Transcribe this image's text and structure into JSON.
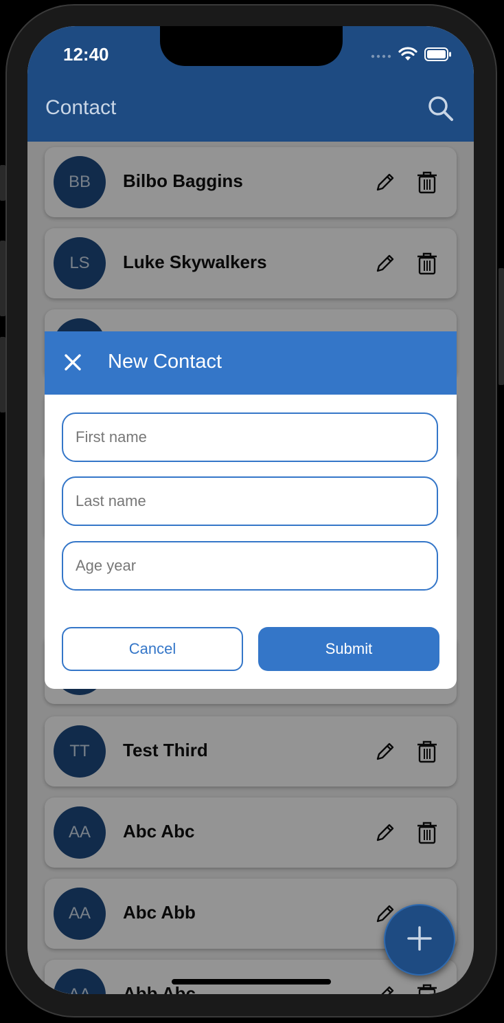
{
  "status": {
    "time": "12:40"
  },
  "appbar": {
    "title": "Contact"
  },
  "contacts": [
    {
      "initials": "BB",
      "name": "Bilbo Baggins"
    },
    {
      "initials": "LS",
      "name": "Luke Skywalkers"
    },
    {
      "initials": "",
      "name": ""
    },
    {
      "initials": "",
      "name": ""
    },
    {
      "initials": "",
      "name": ""
    },
    {
      "initials": "",
      "name": ""
    },
    {
      "initials": "TT",
      "name": "Test Third"
    },
    {
      "initials": "AA",
      "name": "Abc Abc"
    },
    {
      "initials": "AA",
      "name": "Abc Abb"
    },
    {
      "initials": "AA",
      "name": "Abb Abc"
    }
  ],
  "dialog": {
    "title": "New Contact",
    "fields": {
      "first_name_placeholder": "First name",
      "last_name_placeholder": "Last name",
      "age_placeholder": "Age year"
    },
    "cancel_label": "Cancel",
    "submit_label": "Submit"
  },
  "colors": {
    "primary_dark": "#1e4b82",
    "primary": "#3476c8"
  }
}
